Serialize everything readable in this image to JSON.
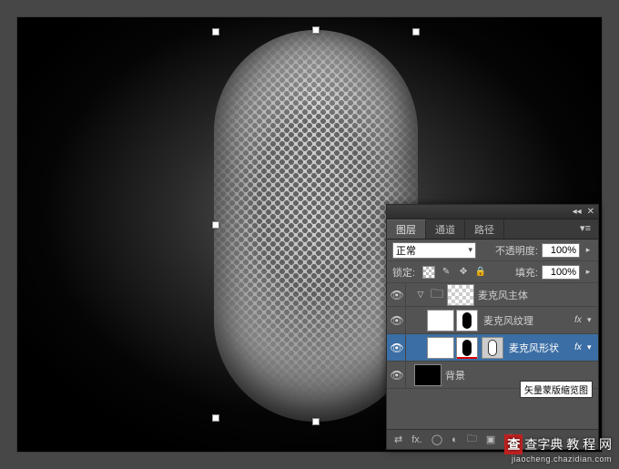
{
  "panel": {
    "tabs": {
      "layers": "图层",
      "channels": "通道",
      "paths": "路径"
    },
    "blend_mode": "正常",
    "opacity_label": "不透明度:",
    "opacity_value": "100%",
    "lock_label": "锁定:",
    "fill_label": "填充:",
    "fill_value": "100%",
    "fx_label": "fx"
  },
  "layers": {
    "group": "麦克风主体",
    "texture": "麦克风纹理",
    "shape": "麦克风形状",
    "background": "背景",
    "vector_tooltip": "矢量蒙版缩览图"
  },
  "watermark": {
    "main": "查字典 教 程 网",
    "sub": "jiaocheng.chazidian.com"
  }
}
